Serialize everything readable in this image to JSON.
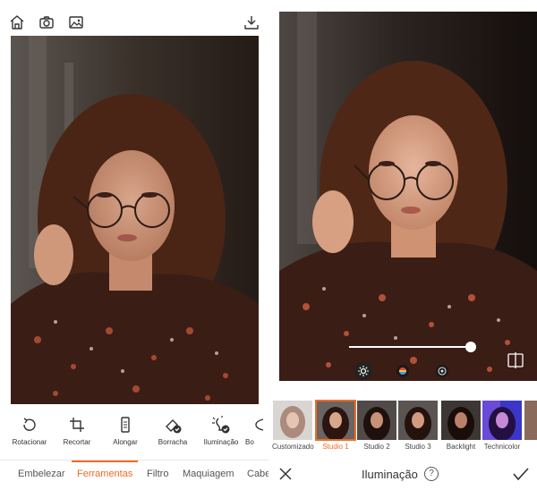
{
  "left": {
    "topbar": {
      "icons": [
        "home-icon",
        "camera-icon",
        "gallery-icon",
        "download-icon"
      ]
    },
    "tools": [
      {
        "label": "Rotacionar",
        "icon": "rotate-icon"
      },
      {
        "label": "Recortar",
        "icon": "crop-icon"
      },
      {
        "label": "Alongar",
        "icon": "stretch-icon"
      },
      {
        "label": "Borracha",
        "icon": "eraser-icon"
      },
      {
        "label": "Iluminação",
        "icon": "lighting-icon"
      },
      {
        "label": "Bo",
        "icon": "cutoff-icon"
      }
    ],
    "nav_tabs": [
      {
        "label": "Embelezar"
      },
      {
        "label": "Ferramentas"
      },
      {
        "label": "Filtro"
      },
      {
        "label": "Maquiagem"
      },
      {
        "label": "Cabe"
      }
    ],
    "active_tab": "Ferramentas"
  },
  "right": {
    "slider": {
      "value": 1.0
    },
    "modes": [
      "brightness-icon",
      "color-icon",
      "lens-icon"
    ],
    "filters": [
      {
        "label": "Customizado"
      },
      {
        "label": "Studio 1"
      },
      {
        "label": "Studio 2"
      },
      {
        "label": "Studio 3"
      },
      {
        "label": "Backlight"
      },
      {
        "label": "Technicolor"
      }
    ],
    "selected_filter": "Studio 1",
    "bottom": {
      "title": "Iluminação",
      "help": "?"
    }
  },
  "colors": {
    "accent": "#f26a22"
  }
}
